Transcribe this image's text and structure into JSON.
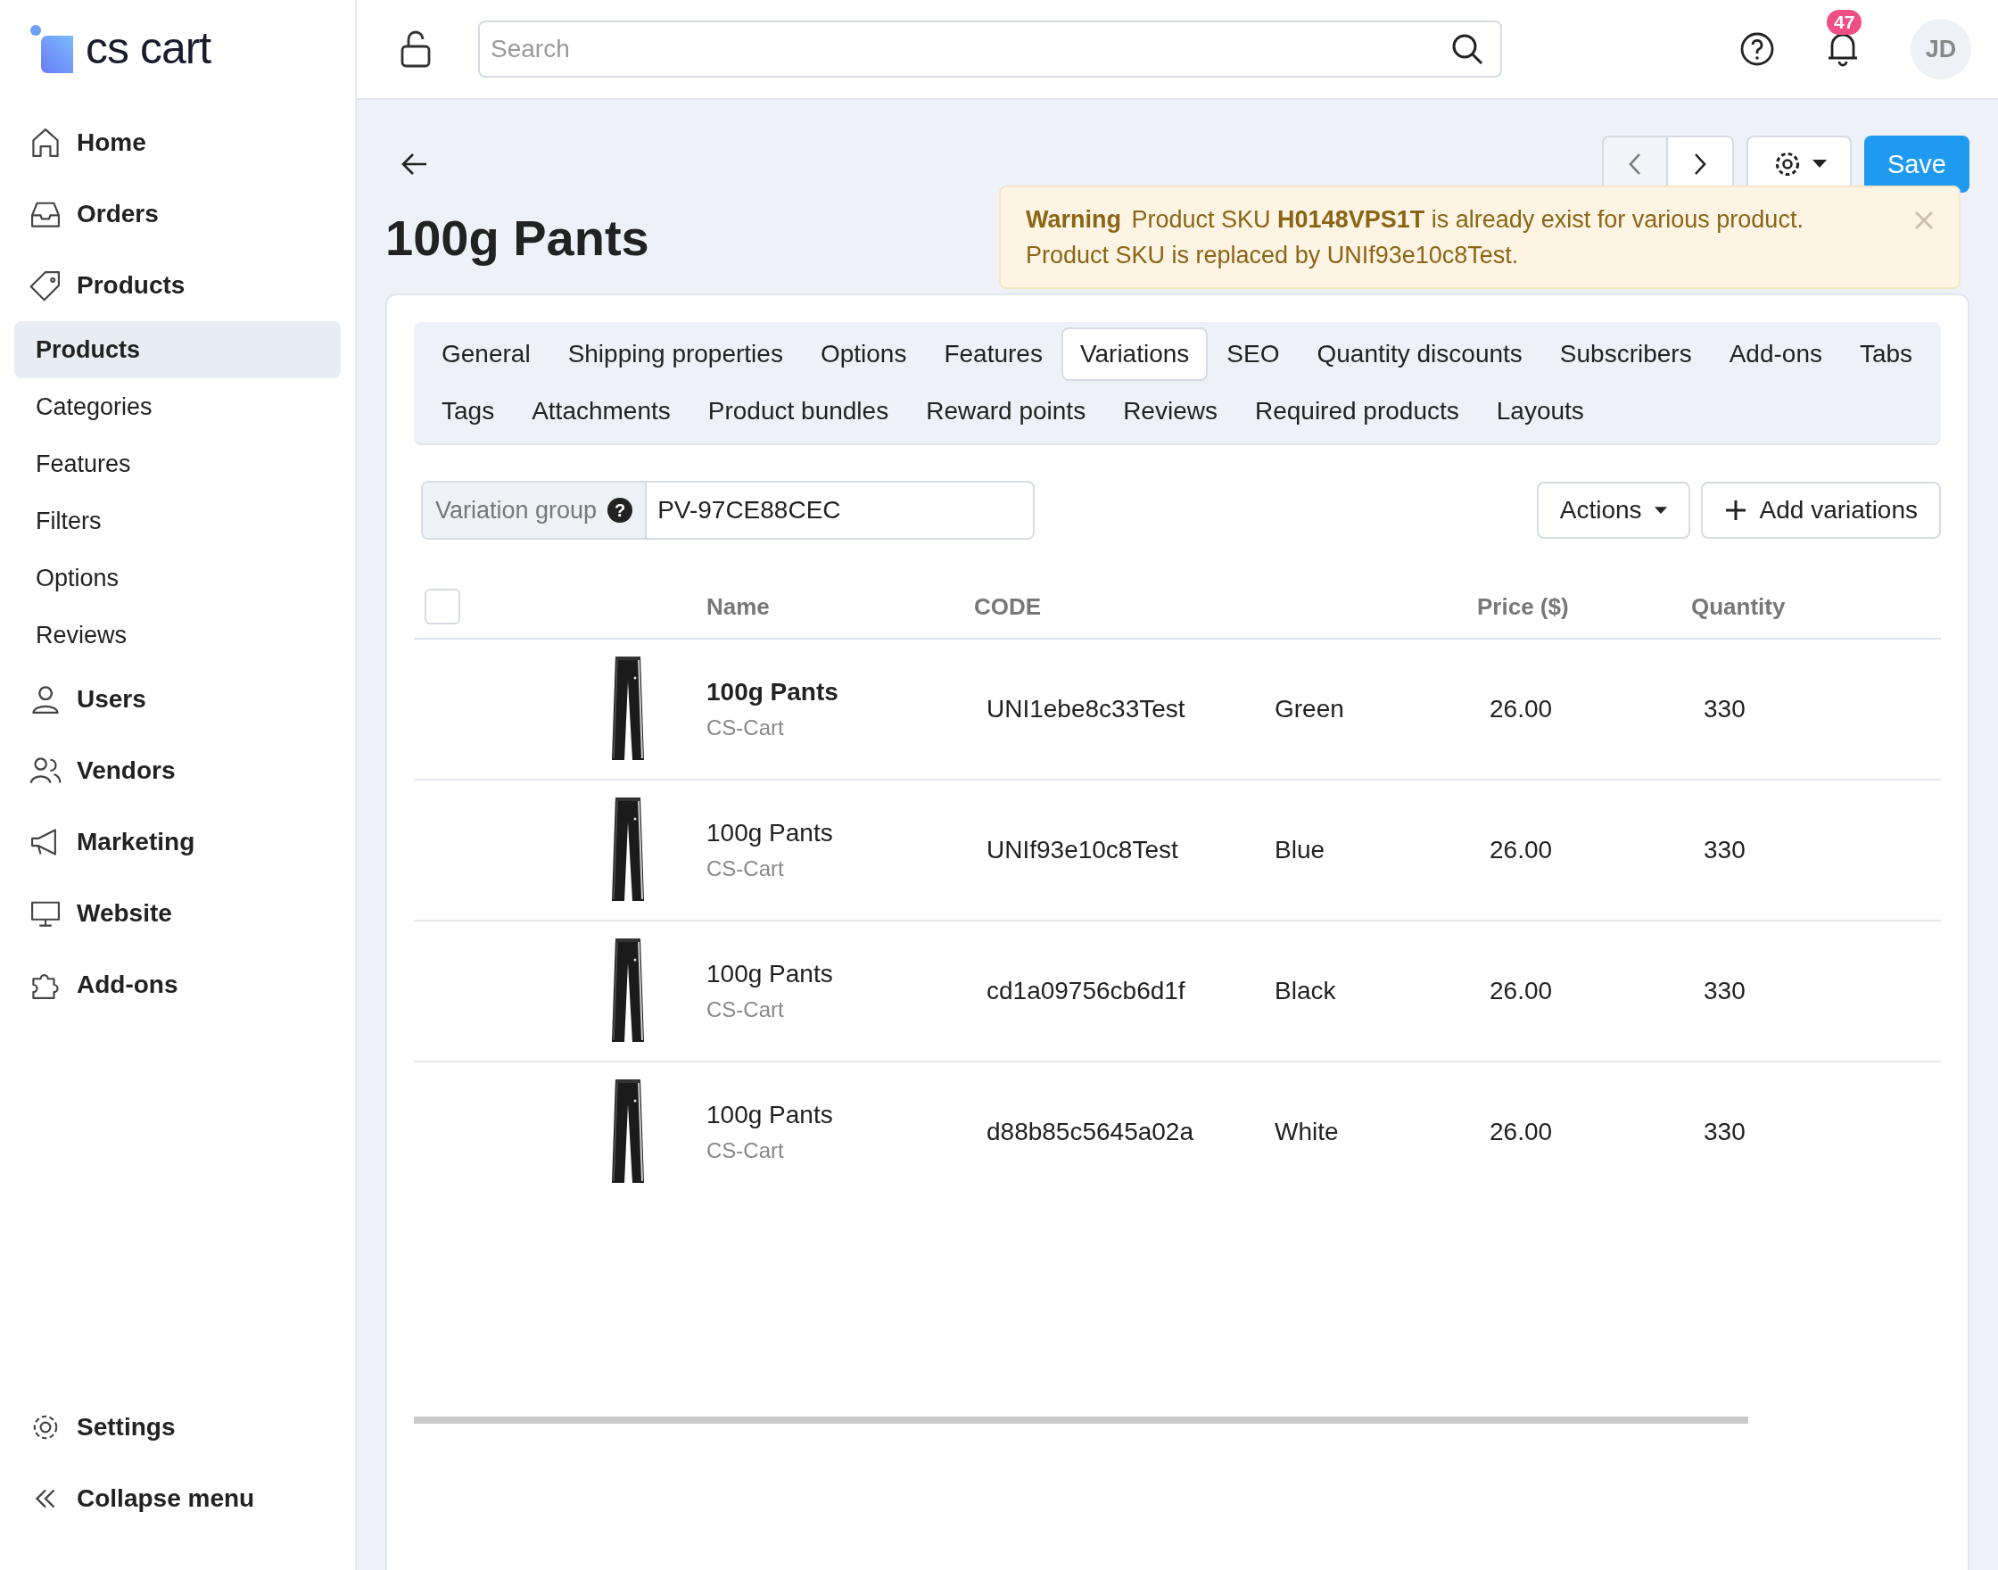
{
  "logo": {
    "text": "cs cart"
  },
  "sidebar": {
    "items": [
      {
        "label": "Home"
      },
      {
        "label": "Orders"
      },
      {
        "label": "Products",
        "children": [
          {
            "label": "Products",
            "selected": true
          },
          {
            "label": "Categories",
            "selected": false
          },
          {
            "label": "Features",
            "selected": false
          },
          {
            "label": "Filters",
            "selected": false
          },
          {
            "label": "Options",
            "selected": false
          },
          {
            "label": "Reviews",
            "selected": false
          }
        ]
      },
      {
        "label": "Users"
      },
      {
        "label": "Vendors"
      },
      {
        "label": "Marketing"
      },
      {
        "label": "Website"
      },
      {
        "label": "Add-ons"
      }
    ],
    "footer": [
      "Settings",
      "Collapse menu"
    ]
  },
  "header": {
    "search": {
      "placeholder": "Search"
    },
    "notifications": "47",
    "avatar": "JD"
  },
  "page": {
    "title": "100g Pants",
    "save": "Save"
  },
  "warning": {
    "title": "Warning",
    "message": "Product SKU **H0148VPS1T** is already exist for various product. Product SKU is replaced by UNIf93e10c8Test."
  },
  "tabs": [
    {
      "label": "General",
      "selected": false
    },
    {
      "label": "Shipping properties",
      "selected": false
    },
    {
      "label": "Options",
      "selected": false
    },
    {
      "label": "Features",
      "selected": false
    },
    {
      "label": "Variations",
      "selected": true
    },
    {
      "label": "SEO",
      "selected": false
    },
    {
      "label": "Quantity discounts",
      "selected": false
    },
    {
      "label": "Subscribers",
      "selected": false
    },
    {
      "label": "Add-ons",
      "selected": false
    },
    {
      "label": "Tabs",
      "selected": false
    },
    {
      "label": "Tags",
      "selected": false
    },
    {
      "label": "Attachments",
      "selected": false
    },
    {
      "label": "Product bundles",
      "selected": false
    },
    {
      "label": "Reward points",
      "selected": false
    },
    {
      "label": "Reviews",
      "selected": false
    },
    {
      "label": "Required products",
      "selected": false
    },
    {
      "label": "Layouts",
      "selected": false
    }
  ],
  "variation_group": {
    "label": "Variation group",
    "help": "?",
    "value": "PV-97CE88CEC"
  },
  "actions": {
    "menu": "Actions",
    "add": "Add variations"
  },
  "table": {
    "all_checked": false,
    "columns": [
      "Name",
      "CODE",
      "Price ($)",
      "Quantity"
    ],
    "rows": [
      {
        "name": "100g Pants",
        "vendor": "CS-Cart",
        "current": true,
        "code": "UNI1ebe8c33Test",
        "color_name": "Green",
        "price": "26.00",
        "quantity": "330"
      },
      {
        "name": "100g Pants",
        "vendor": "CS-Cart",
        "current": false,
        "code": "UNIf93e10c8Test",
        "color_name": "Blue",
        "price": "26.00",
        "quantity": "330"
      },
      {
        "name": "100g Pants",
        "vendor": "CS-Cart",
        "current": false,
        "code": "cd1a09756cb6d1f",
        "color_name": "Black",
        "price": "26.00",
        "quantity": "330"
      },
      {
        "name": "100g Pants",
        "vendor": "CS-Cart",
        "current": false,
        "code": "d88b85c5645a02a",
        "color_name": "White",
        "price": "26.00",
        "quantity": "330"
      }
    ]
  }
}
